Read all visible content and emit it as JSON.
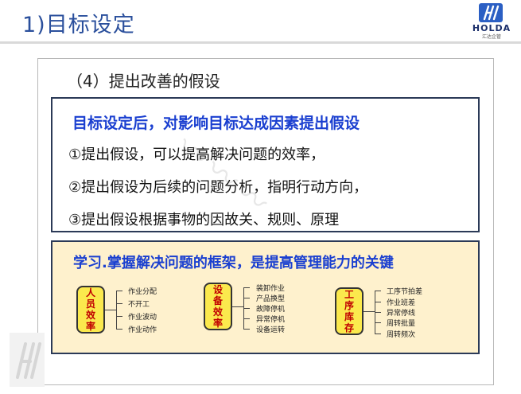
{
  "header": {
    "title": "1)目标设定",
    "logo_name": "HOLDA",
    "logo_sub": "汇达企管"
  },
  "subtitle": "（4）提出改善的假设",
  "box1": {
    "heading": "目标设定后，对影响目标达成因素提出假设",
    "lines": [
      "①提出假设，可以提高解决问题的效率，",
      "②提出假设为后续的问题分析，指明行动方向，",
      "③提出假设根据事物的因故关、规则、原理"
    ]
  },
  "box2": {
    "heading": "学习.掌握解决问题的框架，是提高管理能力的关键",
    "groups": [
      {
        "chars": [
          "人",
          "员",
          "效",
          "率"
        ],
        "items": [
          "作业分配",
          "不开工",
          "作业波动",
          "作业动作"
        ]
      },
      {
        "chars": [
          "设",
          "备",
          "效",
          "率"
        ],
        "items": [
          "装卸作业",
          "产品换型",
          "故障停机",
          "异常停机",
          "设备运转"
        ]
      },
      {
        "chars": [
          "工",
          "序",
          "库",
          "存"
        ],
        "items": [
          "工序节拍差",
          "作业班差",
          "异常停线",
          "周转批量",
          "周转频次"
        ]
      }
    ]
  },
  "colors": {
    "accent": "#1a3fd0",
    "title": "#2a4f9c",
    "box2_bg": "#fef1cd",
    "tag_bg": "#fbe94d",
    "tag_text": "#c00000"
  }
}
